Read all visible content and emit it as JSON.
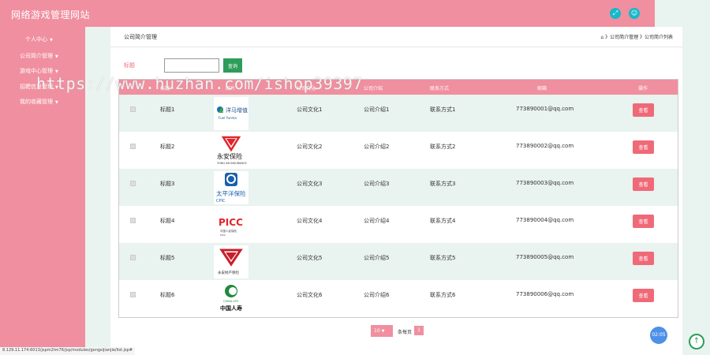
{
  "header": {
    "title": "网络游戏管理网站",
    "icon1": "expand-icon",
    "icon2": "user-icon"
  },
  "sidebar": {
    "items": [
      {
        "label": "个人中心"
      },
      {
        "label": "公司简介管理"
      },
      {
        "label": "游戏中心管理"
      },
      {
        "label": "招聘信息管理"
      },
      {
        "label": "我的收藏管理"
      }
    ]
  },
  "panel": {
    "title": "公司简介管理",
    "breadcrumb": "公司简介管理 》公司简介列表"
  },
  "search": {
    "label": "标题",
    "value": "",
    "button": "查询"
  },
  "table": {
    "headers": [
      "标题",
      "图片",
      "公司文化",
      "公司介绍",
      "联系方式",
      "邮箱",
      "操作"
    ],
    "rows": [
      {
        "title": "标题1",
        "culture": "公司文化1",
        "intro": "公司介绍1",
        "contact": "联系方式1",
        "email": "773890001@qq.com",
        "action": "查看",
        "logo": "Fuel Yunma"
      },
      {
        "title": "标题2",
        "culture": "公司文化2",
        "intro": "公司介绍2",
        "contact": "联系方式2",
        "email": "773890002@qq.com",
        "action": "查看",
        "logo": "永安保险"
      },
      {
        "title": "标题3",
        "culture": "公司文化3",
        "intro": "公司介绍3",
        "contact": "联系方式3",
        "email": "773890003@qq.com",
        "action": "查看",
        "logo": "太平洋保险"
      },
      {
        "title": "标题4",
        "culture": "公司文化4",
        "intro": "公司介绍4",
        "contact": "联系方式4",
        "email": "773890004@qq.com",
        "action": "查看",
        "logo": "PICC"
      },
      {
        "title": "标题5",
        "culture": "公司文化5",
        "intro": "公司介绍5",
        "contact": "联系方式5",
        "email": "773890005@qq.com",
        "action": "查看",
        "logo": "永安财产保险"
      },
      {
        "title": "标题6",
        "culture": "公司文化6",
        "intro": "公司介绍6",
        "contact": "联系方式6",
        "email": "773890006@qq.com",
        "action": "查看",
        "logo": "中国人寿"
      }
    ]
  },
  "pager": {
    "page_size": "10",
    "label": "条每页",
    "current": "1"
  },
  "timer": "02:05",
  "statusbar": "8.129.11.174:6013/jspm2tm76/jsp/modules/gongsijianjie/list.jsp#",
  "watermark": "https://www.huzhan.com/ishop39397",
  "colors": {
    "primary": "#f08f9f",
    "accent": "#ef6a78",
    "green": "#2e9c5a",
    "bg": "#e9f3ef"
  }
}
